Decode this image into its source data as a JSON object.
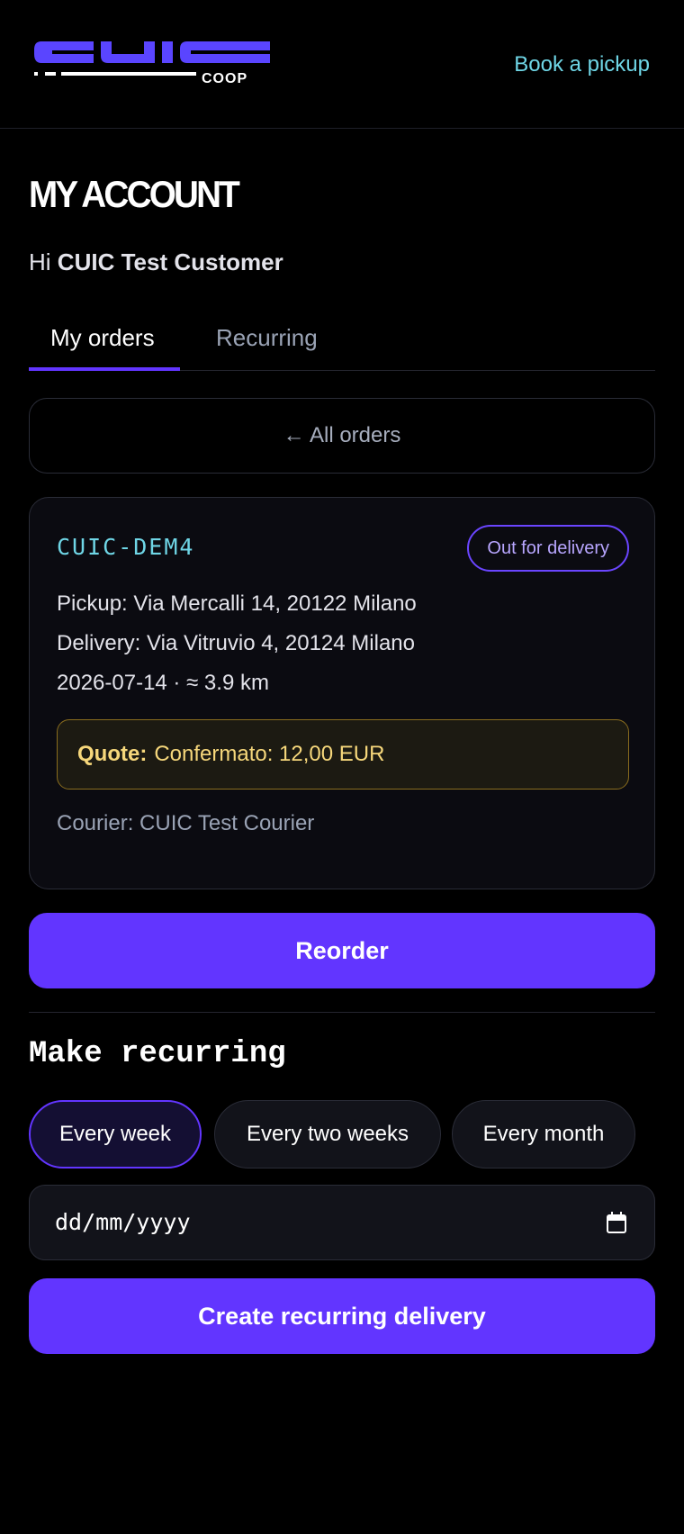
{
  "header": {
    "logo_text": "CUIC",
    "logo_subtext": "COOP",
    "book_link": "Book a pickup"
  },
  "account": {
    "title": "MY ACCOUNT",
    "greeting_prefix": "Hi",
    "customer_name": "CUIC Test Customer"
  },
  "tabs": [
    {
      "label": "My orders",
      "active": true
    },
    {
      "label": "Recurring",
      "active": false
    }
  ],
  "back_button": "← All orders",
  "order": {
    "id": "CUIC-DEM4",
    "status": "Out for delivery",
    "pickup": "Pickup: Via Mercalli 14, 20122 Milano",
    "delivery": "Delivery: Via Vitruvio 4, 20124 Milano",
    "date_distance": "2026-07-14 · ≈ 3.9 km",
    "quote_label": "Quote:",
    "quote_value": "Confermato: 12,00 EUR",
    "courier": "Courier: CUIC Test Courier"
  },
  "reorder_button": "Reorder",
  "recurring": {
    "title": "Make recurring",
    "options": [
      {
        "label": "Every week",
        "selected": true
      },
      {
        "label": "Every two weeks",
        "selected": false
      },
      {
        "label": "Every month",
        "selected": false
      }
    ],
    "date_placeholder": "dd/mm/yyyy",
    "create_button": "Create recurring delivery"
  },
  "colors": {
    "accent": "#6235ff",
    "link": "#6fd6e6",
    "quote": "#f6d77b",
    "logo": "#5a45ff"
  }
}
